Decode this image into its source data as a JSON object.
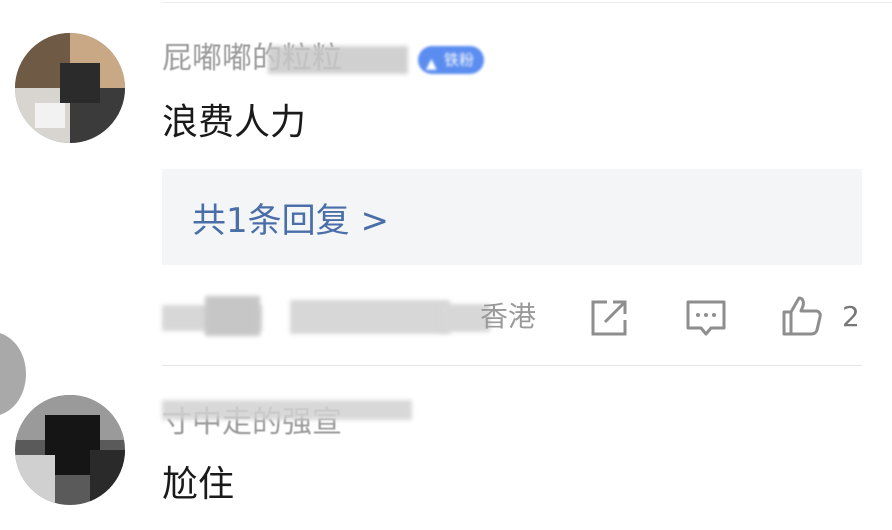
{
  "comments": [
    {
      "username": "屁嘟嘟的粒粒",
      "badge_label": "铁粉",
      "badge_icon": "fan-badge-icon",
      "text": "浪费人力",
      "reply_summary": "共1条回复 >",
      "meta_visible": "香港",
      "like_count": "2"
    },
    {
      "username": "寸中走的强宣",
      "text": "尬住"
    }
  ],
  "icons": {
    "share": "share-icon",
    "comment": "comment-icon",
    "like": "thumbs-up-icon"
  },
  "colors": {
    "reply_link": "#4a6ea8",
    "badge": "#5b8df0",
    "meta": "#9a9a9a"
  }
}
